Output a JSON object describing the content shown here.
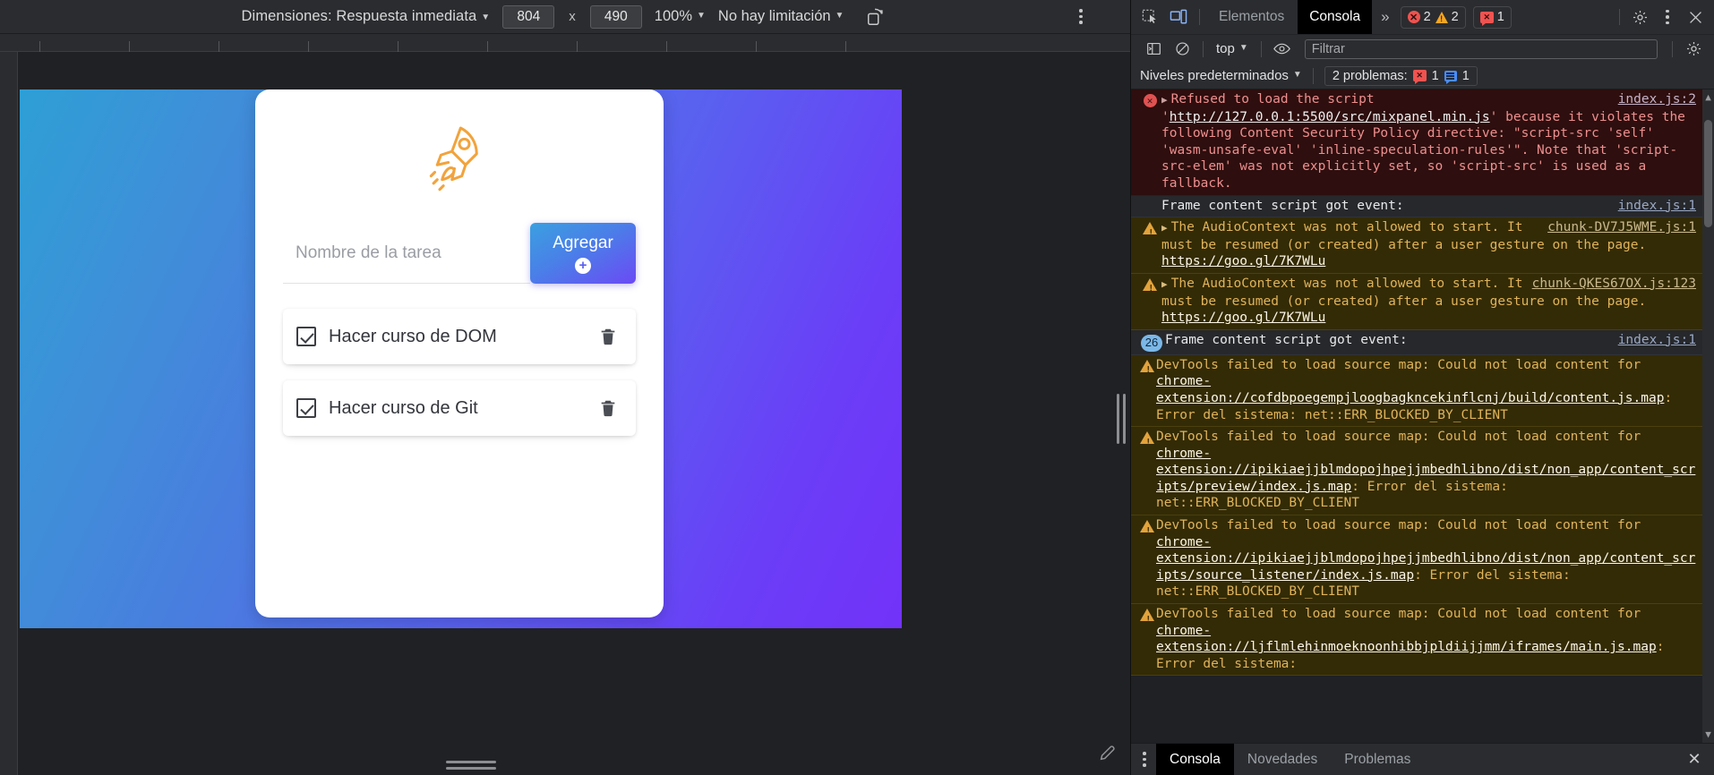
{
  "device_toolbar": {
    "dimensions_label": "Dimensiones: Respuesta inmediata",
    "width_value": "804",
    "height_value": "490",
    "x_separator": "x",
    "zoom_label": "100%",
    "throttling_label": "No hay limitación",
    "rotate_icon": "rotate-device-icon",
    "more_options_icon": "kebab-menu-icon"
  },
  "app": {
    "logo_icon": "rocket-icon",
    "input_placeholder": "Nombre de la tarea",
    "input_value": "",
    "add_button_label": "Agregar",
    "add_button_icon": "plus-circle-icon",
    "tasks": [
      {
        "label": "Hacer curso de DOM",
        "checked": true,
        "delete_icon": "trash-icon"
      },
      {
        "label": "Hacer curso de Git",
        "checked": true,
        "delete_icon": "trash-icon"
      }
    ]
  },
  "devtools": {
    "inspect_icon": "inspect-element-icon",
    "device_toggle_icon": "device-toolbar-icon",
    "tabs": [
      {
        "label": "Elementos",
        "active": false
      },
      {
        "label": "Consola",
        "active": true
      }
    ],
    "more_tabs_label": "»",
    "badges": {
      "errors": "2",
      "warnings": "2",
      "issues": "1"
    },
    "settings_icon": "gear-icon",
    "main_menu_icon": "kebab-menu-icon",
    "close_icon": "close-icon"
  },
  "console_toolbar": {
    "sidebar_icon": "console-sidebar-icon",
    "clear_icon": "clear-console-icon",
    "context_label": "top",
    "eye_icon": "live-expressions-eye-icon",
    "filter_placeholder": "Filtrar",
    "filter_value": "",
    "settings_icon": "gear-icon"
  },
  "console_subbar": {
    "levels_label": "Niveles predeterminados",
    "problems_label": "2 problemas:",
    "problems_error_count": "1",
    "problems_info_count": "1"
  },
  "console_messages": [
    {
      "type": "error",
      "icon": "error-circle-icon",
      "expandable": true,
      "source": "index.js:2",
      "segments": [
        {
          "t": "Refused to load the script '",
          "link": false
        },
        {
          "t": "http://127.0.0.1:5500/src/mixpanel.min.js",
          "link": true
        },
        {
          "t": "' because it violates the following Content Security Policy directive: \"script-src 'self' 'wasm-unsafe-eval' 'inline-speculation-rules'\". Note that 'script-src-elem' was not explicitly set, so 'script-src' is used as a fallback.",
          "link": false
        }
      ]
    },
    {
      "type": "info",
      "icon": "",
      "expandable": false,
      "source": "index.js:1",
      "segments": [
        {
          "t": "Frame content script got event:",
          "link": false
        }
      ]
    },
    {
      "type": "warn",
      "icon": "warning-triangle-icon",
      "expandable": true,
      "source": "chunk-DV7J5WME.js:1",
      "segments": [
        {
          "t": "The AudioContext was not allowed to start. It must be resumed (or created) after a user gesture on the page. ",
          "link": false
        },
        {
          "t": "https://goo.gl/7K7WLu",
          "link": true
        }
      ]
    },
    {
      "type": "warn",
      "icon": "warning-triangle-icon",
      "expandable": true,
      "source": "chunk-QKES67OX.js:123",
      "segments": [
        {
          "t": "The AudioContext was not allowed to start. It must be resumed (or created) after a user gesture on the page. ",
          "link": false
        },
        {
          "t": "https://goo.gl/7K7WLu",
          "link": true
        }
      ]
    },
    {
      "type": "info",
      "icon": "repeat-count-badge",
      "count": "26",
      "expandable": false,
      "source": "index.js:1",
      "segments": [
        {
          "t": "Frame content script got event:",
          "link": false
        }
      ]
    },
    {
      "type": "warn",
      "icon": "warning-triangle-icon",
      "expandable": false,
      "source": "",
      "segments": [
        {
          "t": "DevTools failed to load source map: Could not load content for ",
          "link": false
        },
        {
          "t": "chrome-extension://cofdbpoegempjloogbagkncekinflcnj/build/content.js.map",
          "link": true
        },
        {
          "t": ": Error del sistema: net::ERR_BLOCKED_BY_CLIENT",
          "link": false
        }
      ]
    },
    {
      "type": "warn",
      "icon": "warning-triangle-icon",
      "expandable": false,
      "source": "",
      "segments": [
        {
          "t": "DevTools failed to load source map: Could not load content for ",
          "link": false
        },
        {
          "t": "chrome-extension://ipikiaejjblmdopojhpejjmbedhlibno/dist/non_app/content_scripts/preview/index.js.map",
          "link": true
        },
        {
          "t": ": Error del sistema: net::ERR_BLOCKED_BY_CLIENT",
          "link": false
        }
      ]
    },
    {
      "type": "warn",
      "icon": "warning-triangle-icon",
      "expandable": false,
      "source": "",
      "segments": [
        {
          "t": "DevTools failed to load source map: Could not load content for ",
          "link": false
        },
        {
          "t": "chrome-extension://ipikiaejjblmdopojhpejjmbedhlibno/dist/non_app/content_scripts/source_listener/index.js.map",
          "link": true
        },
        {
          "t": ": Error del sistema: net::ERR_BLOCKED_BY_CLIENT",
          "link": false
        }
      ]
    },
    {
      "type": "warn",
      "icon": "warning-triangle-icon",
      "expandable": false,
      "source": "",
      "segments": [
        {
          "t": "DevTools failed to load source map: Could not load content for ",
          "link": false
        },
        {
          "t": "chrome-extension://ljflmlehinmoeknoonhibbjpldiijjmm/iframes/main.js.map",
          "link": true
        },
        {
          "t": ": Error del sistema:",
          "link": false
        }
      ]
    }
  ],
  "drawer": {
    "menu_icon": "kebab-menu-icon",
    "tabs": [
      {
        "label": "Consola",
        "active": true
      },
      {
        "label": "Novedades",
        "active": false
      },
      {
        "label": "Problemas",
        "active": false
      }
    ],
    "close_icon": "close-icon"
  },
  "colors": {
    "error_red": "#ef5350",
    "warning_orange": "#f5a623",
    "info_blue": "#4a8df8",
    "accent_purple": "#6b4af5",
    "devtools_bg": "#202124"
  }
}
